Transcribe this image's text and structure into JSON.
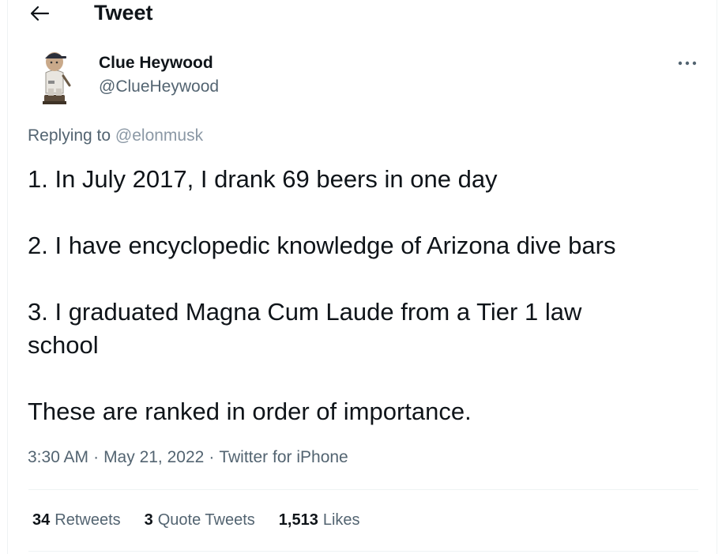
{
  "header": {
    "back_icon": "arrow-left-icon",
    "title": "Tweet"
  },
  "author": {
    "avatar_icon": "bobblehead-avatar",
    "name": "Clue Heywood",
    "handle": "@ClueHeywood",
    "more_icon": "more-dots-icon"
  },
  "reply": {
    "prefix": "Replying to",
    "mention": "@elonmusk"
  },
  "tweet": {
    "line1": "1. In July 2017, I drank 69 beers in one day",
    "line2": "2. I have encyclopedic knowledge of Arizona dive bars",
    "line3a": "3. I graduated Magna Cum Laude from a Tier 1 law",
    "line3b": "school",
    "line4": "These are ranked in order of importance."
  },
  "meta": {
    "time": "3:30 AM",
    "dot1": "·",
    "date": "May 21, 2022",
    "dot2": "·",
    "source": "Twitter for iPhone"
  },
  "stats": {
    "retweets_count": "34",
    "retweets_label": "Retweets",
    "quotes_count": "3",
    "quotes_label": "Quote Tweets",
    "likes_count": "1,513",
    "likes_label": "Likes"
  }
}
